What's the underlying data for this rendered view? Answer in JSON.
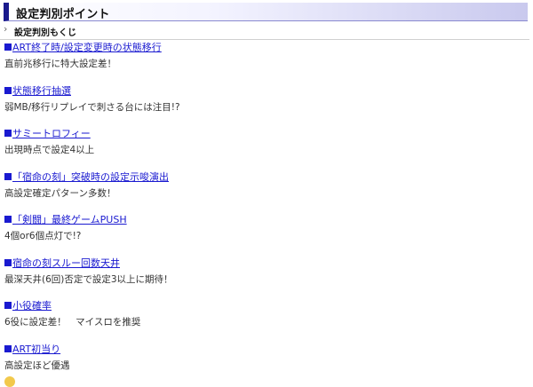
{
  "header": {
    "title": "設定判別ポイント"
  },
  "breadcrumb": {
    "label": "設定判別もくじ"
  },
  "entries": [
    {
      "link": "ART終了時/設定変更時の状態移行",
      "desc": "直前兆移行に特大設定差！"
    },
    {
      "link": "状態移行抽選",
      "desc": "弱MB/移行リプレイで刺さる台には注目!?"
    },
    {
      "link": "サミートロフィー",
      "desc": "出現時点で設定4以上"
    },
    {
      "link": "「宿命の刻」突破時の設定示唆演出",
      "desc": "高設定確定パターン多数！"
    },
    {
      "link": "「剣闘」最終ゲームPUSH",
      "desc": "4個or6個点灯で!?"
    },
    {
      "link": "宿命の刻スルー回数天井",
      "desc": "最深天井(6回)否定で設定3以上に期待！"
    },
    {
      "link": "小役確率",
      "desc": "6役に設定差！　マイスロを推奨"
    },
    {
      "link": "ART初当り",
      "desc": "高設定ほど優遇"
    }
  ],
  "colors": {
    "link": "#1a1ad0",
    "header_accent": "#1a1a8c"
  }
}
